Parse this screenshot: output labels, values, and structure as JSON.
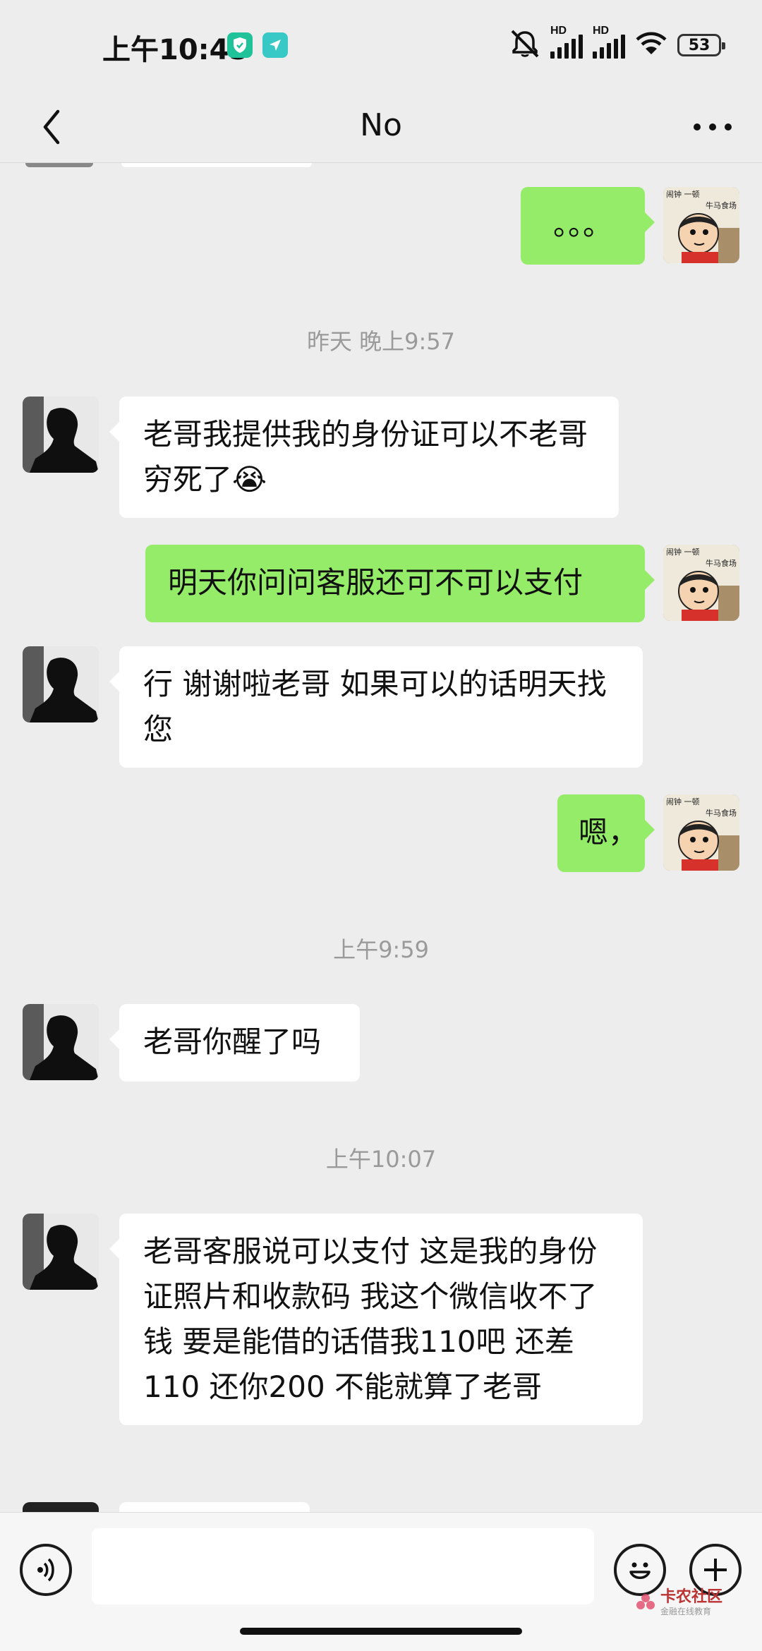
{
  "status_bar": {
    "time": "上午10:45",
    "battery": "53",
    "icons": [
      "shield-badge-icon",
      "navigation-badge-icon",
      "mute-icon",
      "hd-signal-icon",
      "hd-signal-icon",
      "wifi-icon",
      "battery-icon"
    ],
    "hd_label": "HD"
  },
  "header": {
    "title": "No",
    "back_icon": "chevron-left-icon",
    "more_icon": "more-dots-icon"
  },
  "messages": [
    {
      "side": "self",
      "text": "。。。"
    },
    {
      "type": "time",
      "text": "昨天 晚上9:57"
    },
    {
      "side": "other",
      "text": "老哥我提供我的身份证可以不老哥 穷死了😭"
    },
    {
      "side": "self",
      "text": "明天你问问客服还可不可以支付"
    },
    {
      "side": "other",
      "text": "行 谢谢啦老哥 如果可以的话明天找您"
    },
    {
      "side": "self",
      "text": "嗯，"
    },
    {
      "type": "time",
      "text": "上午9:59"
    },
    {
      "side": "other",
      "text": "老哥你醒了吗"
    },
    {
      "type": "time",
      "text": "上午10:07"
    },
    {
      "side": "other",
      "text": "老哥客服说可以支付 这是我的身份证照片和收款码 我这个微信收不了钱 要是能借的话借我110吧 还差110  还你200 不能就算了老哥"
    }
  ],
  "self_avatar_caption": {
    "line1": "闹钟 一顿",
    "line2": "牛马食场"
  },
  "input_bar": {
    "placeholder": "",
    "voice_icon": "voice-icon",
    "emoji_icon": "emoji-icon",
    "plus_icon": "plus-icon"
  },
  "watermark": {
    "title": "卡农社区",
    "subtitle": "金融在线教育"
  },
  "colors": {
    "self_bubble": "#95ec69",
    "other_bubble": "#ffffff",
    "background": "#ededed"
  }
}
